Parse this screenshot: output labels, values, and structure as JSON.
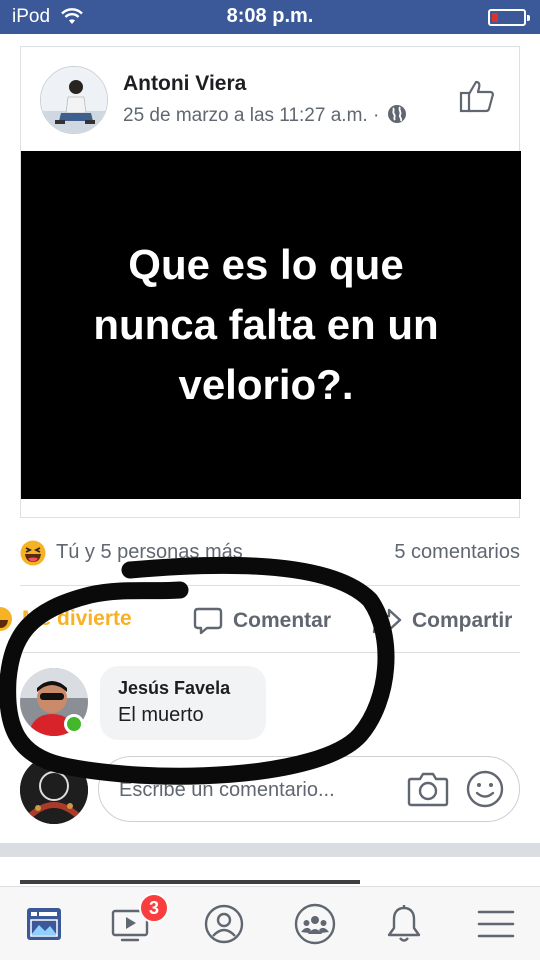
{
  "status_bar": {
    "carrier": "iPod",
    "time": "8:08 p.m."
  },
  "post": {
    "author": "Antoni Viera",
    "timestamp": "25 de marzo a las 11:27 a.m. ·",
    "privacy_icon": "globe-icon",
    "image_text": "Que es lo que nunca falta en un velorio?."
  },
  "reactions": {
    "summary": "Tú y 5 personas más",
    "comments_count": "5 comentarios"
  },
  "actions": {
    "react_label": "Me divierte",
    "comment_label": "Comentar",
    "share_label": "Compartir"
  },
  "comment": {
    "author": "Jesús Favela",
    "text": "El muerto"
  },
  "compose": {
    "placeholder": "Escribe un comentario..."
  },
  "bottom_nav": {
    "items": [
      "news-feed-icon",
      "watch-icon",
      "profile-icon",
      "groups-icon",
      "notifications-icon",
      "menu-icon"
    ],
    "watch_badge": "3"
  },
  "colors": {
    "facebook_blue": "#3b5998",
    "badge_red": "#fa3e3e",
    "haha_yellow": "#f7b125",
    "online_green": "#42b72a"
  }
}
